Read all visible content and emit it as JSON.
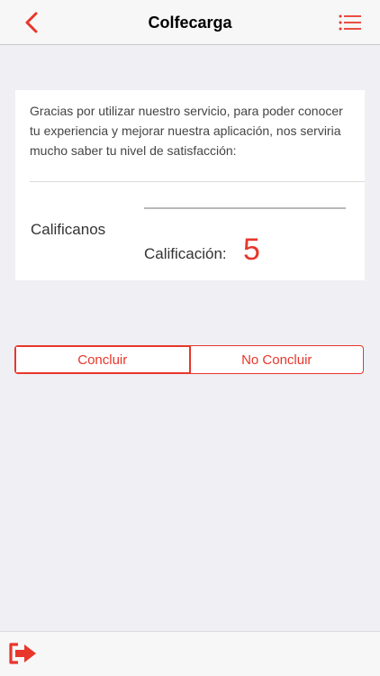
{
  "header": {
    "title": "Colfecarga",
    "back_icon": "chevron-left-icon",
    "menu_icon": "list-menu-icon"
  },
  "survey": {
    "intro": "Gracias por utilizar nuestro servicio, para poder conocer tu experiencia y mejorar nuestra aplicación, nos serviria mucho saber tu nivel de satisfacción:",
    "rate_label": "Calificanos",
    "score_label": "Calificación:",
    "score_value": "5"
  },
  "actions": {
    "conclude_label": "Concluir",
    "not_conclude_label": "No Concluir"
  },
  "footer": {
    "logout_icon": "logout-icon"
  },
  "colors": {
    "accent": "#e8362b",
    "background": "#efeff4"
  }
}
